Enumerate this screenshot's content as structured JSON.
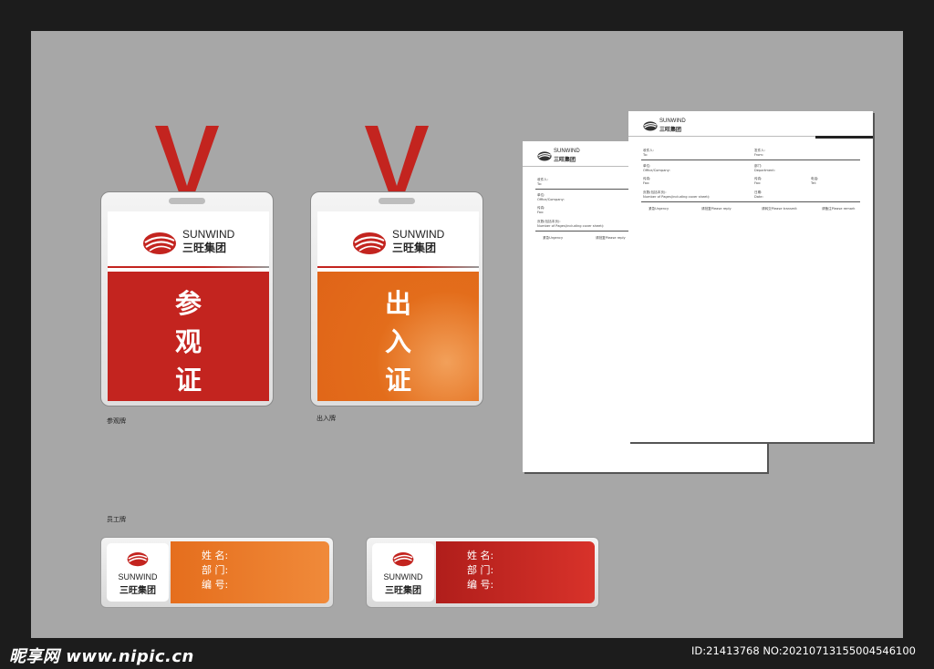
{
  "brand": {
    "name_en": "SUNWIND",
    "name_cn": "三旺集团"
  },
  "badges": [
    {
      "title": "参观证",
      "chars": [
        "参",
        "观",
        "证"
      ],
      "caption": "参观牌",
      "color": "#c3241f"
    },
    {
      "title": "出入证",
      "chars": [
        "出",
        "入",
        "证"
      ],
      "caption": "出入牌",
      "color": "#e36d1b"
    }
  ],
  "employee_caption": "员工牌",
  "employee_fields": [
    "姓 名:",
    "部 门:",
    "编 号:"
  ],
  "employee_colors": [
    "#e56e1d",
    "#c3241f"
  ],
  "letterhead": {
    "to_cn": "收件人:",
    "to_en": "To:",
    "from_cn": "发件人:",
    "from_en": "From:",
    "office_cn": "单位:",
    "office_en": "Office/Company:",
    "dept_cn": "部门:",
    "dept_en": "Department:",
    "fax_cn": "传真:",
    "fax_en": "Fax:",
    "fax2_cn": "传真:",
    "fax2_en": "Fax:",
    "tel_cn": "电话:",
    "tel_en": "Tel:",
    "pages_cn": "页数(包括本页):",
    "pages_en": "Number of Pages(including cover sheet):",
    "date_cn": "日期:",
    "date_en": "Date:",
    "urgent": "紧急Urgency",
    "reply": "请批复Please reply",
    "forward": "请转交Please transmit",
    "remark": "请备注Please remark"
  },
  "watermark": {
    "left": "昵享网 www.nipic.cn",
    "right": "ID:21413768 NO:20210713155004546100"
  }
}
